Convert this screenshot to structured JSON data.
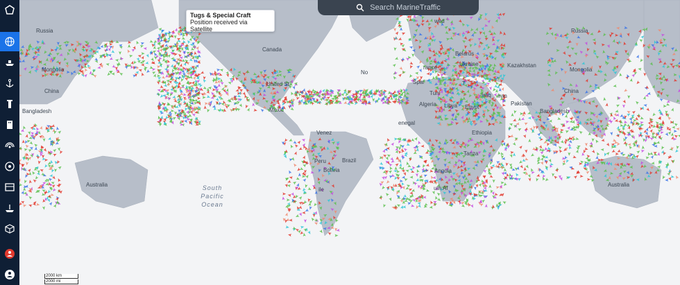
{
  "search": {
    "placeholder": "Search MarineTraffic",
    "icon": "search-icon"
  },
  "tooltip": {
    "title": "Tugs & Special Craft",
    "subtitle": "Position received via Satellite"
  },
  "sidebar": {
    "items": [
      {
        "name": "logo-icon",
        "active": false
      },
      {
        "name": "globe-icon",
        "active": true
      },
      {
        "name": "ship-icon",
        "active": false
      },
      {
        "name": "anchor-icon",
        "active": false
      },
      {
        "name": "lighthouse-icon",
        "active": false
      },
      {
        "name": "building-icon",
        "active": false
      },
      {
        "name": "signal-icon",
        "active": false
      },
      {
        "name": "aperture-icon",
        "active": false
      },
      {
        "name": "layers-panel-icon",
        "active": false
      },
      {
        "name": "ship-dock-icon",
        "active": false
      },
      {
        "name": "cube-icon",
        "active": false
      },
      {
        "name": "user-alert-icon",
        "active": false
      },
      {
        "name": "account-icon",
        "active": false
      }
    ]
  },
  "labels": {
    "russia_left": "Russia",
    "russia_right": "Russia",
    "canada": "Canada",
    "mongolia_left": "Mongolia",
    "mongolia_right": "Mongolia",
    "china_left": "China",
    "china_right": "China",
    "bangladesh_left": "Bangladesh",
    "bangladesh_right": "Bangladesh",
    "australia_left": "Australia",
    "australia_right": "Australia",
    "united_states": "United St",
    "mexico": "Mexic",
    "venezuela": "Venez",
    "peru": "Peru",
    "bolivia": "Bolivia",
    "brazil": "Brazil",
    "belarus": "Belarus",
    "ukraine": "Ukraine",
    "france": "rance",
    "spain": "Spai",
    "tunisia": "Tuni",
    "algeria": "Algeria",
    "libya": "Libya",
    "egypt": "Egypt",
    "iraq": "Iraq",
    "iran": "Iran",
    "pakistan": "Pakistan",
    "kazakhstan": "Kazakhstan",
    "ethiopia": "Ethiopia",
    "tanzania": "Tanza",
    "angola": "Angola",
    "senegal": "enegal",
    "south_africa": "uth Af",
    "chile": "ile",
    "south_pacific_ocean": "South\nPacific\nOcean",
    "norway": "wed",
    "turkey": "T",
    "north_atlantic": "No"
  },
  "scale": {
    "km": "2000 km",
    "mi": "2000 mi"
  },
  "colors": {
    "sidebar": "#0f1f35",
    "sidebar_active": "#1b73e8",
    "land": "#b7bec9",
    "ocean": "#f3f4f6",
    "cargo": "#5bbf4d",
    "tanker": "#e23a2f",
    "passenger": "#3a74e8",
    "tug": "#2ec7d6",
    "fishing": "#ef8a6f",
    "pleasure": "#c54be0"
  }
}
